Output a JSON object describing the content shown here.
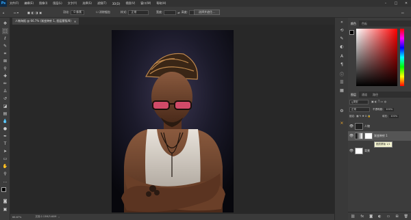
{
  "app": {
    "logo": "Ps",
    "menu": [
      "文件(F)",
      "编辑(E)",
      "图像(I)",
      "图层(L)",
      "文字(Y)",
      "选择(S)",
      "滤镜(T)",
      "3D(D)",
      "视图(V)",
      "窗口(W)",
      "帮助(H)"
    ],
    "window_controls": {
      "minimize": "–",
      "maximize": "□",
      "close": "✕"
    }
  },
  "options": {
    "feather_label": "羽化:",
    "feather_value": "0 像素",
    "style_label": "样式:",
    "style_value": "正常",
    "width_label": "宽度:",
    "height_label": "高度:",
    "select_mask_button": "选择并遮住..."
  },
  "document": {
    "tab_title": "人物海报 @ 66.7% (渐变映射 1, 图层蒙版/8)",
    "close": "×"
  },
  "status": {
    "zoom": "66.67%",
    "doc_info": "文档:2.13M/3.60M"
  },
  "color_panel": {
    "tabs": [
      "颜色",
      "色板"
    ],
    "accent_red": "#ff0000"
  },
  "layers_panel": {
    "tabs": [
      "图层",
      "通道",
      "路径"
    ],
    "filter_value": "类型",
    "blend_mode": "正常",
    "opacity_label": "不透明度:",
    "opacity_value": "100%",
    "lock_label": "锁定:",
    "fill_label": "填充:",
    "fill_value": "100%",
    "layers": [
      {
        "name": "人物",
        "visible": true
      },
      {
        "name": "渐变映射 1",
        "visible": true
      },
      {
        "name": "背景",
        "visible": true
      }
    ],
    "tooltip": "图层蒙版 1/1"
  }
}
